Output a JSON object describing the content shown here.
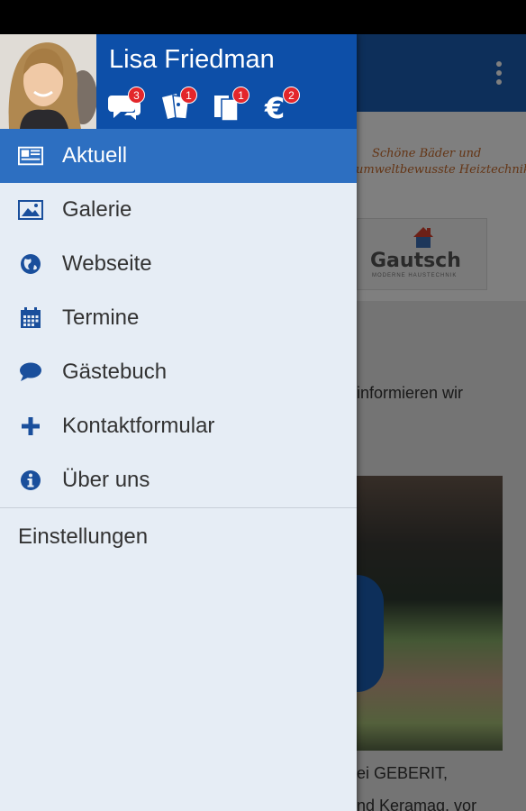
{
  "drawer": {
    "user_name": "Lisa Friedman",
    "stats": [
      {
        "icon": "chat-bubbles-icon",
        "count": "3"
      },
      {
        "icon": "tickets-icon",
        "count": "1"
      },
      {
        "icon": "documents-icon",
        "count": "1"
      },
      {
        "icon": "euro-icon",
        "count": "2"
      }
    ],
    "menu": [
      {
        "icon": "newspaper-icon",
        "label": "Aktuell",
        "active": true
      },
      {
        "icon": "image-icon",
        "label": "Galerie"
      },
      {
        "icon": "globe-icon",
        "label": "Webseite"
      },
      {
        "icon": "calendar-icon",
        "label": "Termine"
      },
      {
        "icon": "speech-bubble-icon",
        "label": "Gästebuch"
      },
      {
        "icon": "plus-icon",
        "label": "Kontaktformular"
      },
      {
        "icon": "info-icon",
        "label": "Über uns"
      }
    ],
    "settings_label": "Einstellungen"
  },
  "background": {
    "banner_line1": "Schöne Bäder und",
    "banner_line2": "umweltbewusste Heiztechnik",
    "logo_word": "Gautsch",
    "logo_sub": "MODERNE HAUSTECHNIK",
    "text_line1": "informieren wir",
    "text_line2": "ei GEBERIT,",
    "text_line3": "nd Keramag, vor"
  },
  "colors": {
    "brand_blue": "#0d4fa8",
    "active_item": "#2d6fc1",
    "drawer_bg": "#e6edf5",
    "badge_red": "#e3262b"
  }
}
